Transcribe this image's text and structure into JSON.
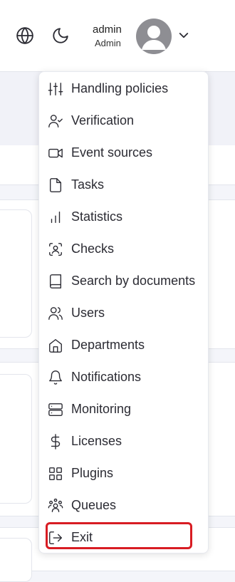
{
  "header": {
    "user_name": "admin",
    "user_role": "Admin",
    "icons": [
      "globe-icon",
      "moon-icon",
      "avatar",
      "chevron-down-icon"
    ]
  },
  "menu": {
    "items": [
      {
        "label": "Handling policies",
        "icon": "sliders-icon"
      },
      {
        "label": "Verification",
        "icon": "user-check-icon"
      },
      {
        "label": "Event sources",
        "icon": "video-icon"
      },
      {
        "label": "Tasks",
        "icon": "file-icon"
      },
      {
        "label": "Statistics",
        "icon": "bar-chart-icon"
      },
      {
        "label": "Checks",
        "icon": "face-scan-icon"
      },
      {
        "label": "Search by documents",
        "icon": "book-icon"
      },
      {
        "label": "Users",
        "icon": "users-icon"
      },
      {
        "label": "Departments",
        "icon": "home-icon"
      },
      {
        "label": "Notifications",
        "icon": "bell-icon"
      },
      {
        "label": "Monitoring",
        "icon": "server-icon"
      },
      {
        "label": "Licenses",
        "icon": "dollar-icon"
      },
      {
        "label": "Plugins",
        "icon": "grid-icon"
      },
      {
        "label": "Queues",
        "icon": "people-group-icon"
      },
      {
        "label": "Exit",
        "icon": "log-out-icon"
      }
    ],
    "highlight_color": "#d81c23"
  }
}
